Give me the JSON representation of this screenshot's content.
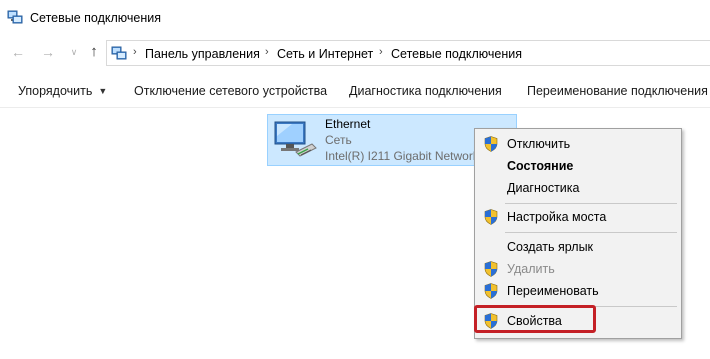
{
  "window": {
    "title": "Сетевые подключения"
  },
  "address": {
    "breadcrumbs": [
      "Панель управления",
      "Сеть и Интернет",
      "Сетевые подключения"
    ]
  },
  "commandbar": {
    "organize": "Упорядочить",
    "disable": "Отключение сетевого устройства",
    "diagnose": "Диагностика подключения",
    "rename": "Переименование подключения"
  },
  "connection": {
    "name": "Ethernet",
    "type": "Сеть",
    "adapter": "Intel(R) I211 Gigabit Network"
  },
  "context_menu": {
    "items": [
      {
        "label": "Отключить",
        "shield": true,
        "bold": false,
        "disabled": false
      },
      {
        "label": "Состояние",
        "shield": false,
        "bold": true,
        "disabled": false
      },
      {
        "label": "Диагностика",
        "shield": false,
        "bold": false,
        "disabled": false
      },
      {
        "label": "Настройка моста",
        "shield": true,
        "bold": false,
        "disabled": false
      },
      {
        "label": "Создать ярлык",
        "shield": false,
        "bold": false,
        "disabled": false
      },
      {
        "label": "Удалить",
        "shield": true,
        "bold": false,
        "disabled": true
      },
      {
        "label": "Переименовать",
        "shield": true,
        "bold": false,
        "disabled": false
      },
      {
        "label": "Свойства",
        "shield": true,
        "bold": false,
        "disabled": false
      }
    ],
    "highlighted_item": "Свойства",
    "highlight_color": "#c42026"
  },
  "colors": {
    "selection_bg": "#cce8ff",
    "selection_border": "#99d1ff",
    "menu_bg": "#f2f2f2"
  },
  "icons": {
    "back": "arrow-left-icon",
    "forward": "arrow-right-icon",
    "recent": "chevron-down-icon",
    "up": "arrow-up-icon",
    "network": "network-adapter-icon",
    "uac": "uac-shield-icon"
  }
}
